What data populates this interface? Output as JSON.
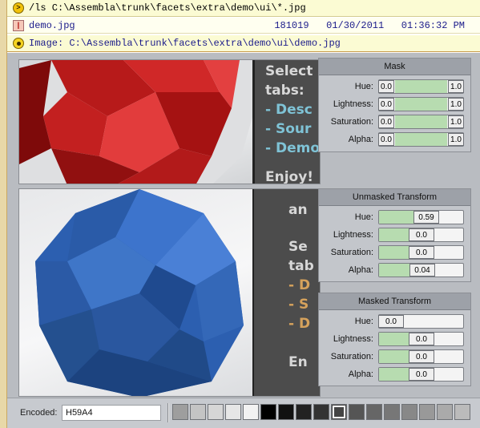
{
  "console": {
    "command": "/ls C:\\Assembla\\trunk\\facets\\extra\\demo\\ui\\*.jpg",
    "file": {
      "name": "demo.jpg",
      "size": "181019",
      "date": "01/30/2011",
      "time": "01:36:32 PM"
    },
    "image_line": "Image: C:\\Assembla\\trunk\\facets\\extra\\demo\\ui\\demo.jpg",
    "icons": [
      "prompt-icon",
      "file-icon",
      "eye-icon"
    ]
  },
  "overlay_top": [
    "Select",
    "tabs:",
    "- Desc",
    "- Sour",
    "- Demo",
    "",
    "Enjoy!"
  ],
  "overlay_bottom": [
    "",
    "an",
    "",
    "Se",
    "tab",
    "- D",
    "- S",
    "- D",
    "",
    "En"
  ],
  "mask": {
    "title": "Mask",
    "rows": [
      {
        "label": "Hue:",
        "lo": "0.0",
        "hi": "1.0",
        "fill": 1.0
      },
      {
        "label": "Lightness:",
        "lo": "0.0",
        "hi": "1.0",
        "fill": 1.0
      },
      {
        "label": "Saturation:",
        "lo": "0.0",
        "hi": "1.0",
        "fill": 1.0
      },
      {
        "label": "Alpha:",
        "lo": "0.0",
        "hi": "1.0",
        "fill": 1.0
      }
    ]
  },
  "unmasked": {
    "title": "Unmasked Transform",
    "rows": [
      {
        "label": "Hue:",
        "value": "0.59",
        "fill": 0.59
      },
      {
        "label": "Lightness:",
        "value": "0.0",
        "fill": 0.5
      },
      {
        "label": "Saturation:",
        "value": "0.0",
        "fill": 0.5
      },
      {
        "label": "Alpha:",
        "value": "0.04",
        "fill": 0.52
      }
    ]
  },
  "masked": {
    "title": "Masked Transform",
    "rows": [
      {
        "label": "Hue:",
        "value": "0.0",
        "fill": 0.0
      },
      {
        "label": "Lightness:",
        "value": "0.0",
        "fill": 0.5
      },
      {
        "label": "Saturation:",
        "value": "0.0",
        "fill": 0.5
      },
      {
        "label": "Alpha:",
        "value": "0.0",
        "fill": 0.5
      }
    ]
  },
  "encoded": {
    "label": "Encoded:",
    "value": "H59A4"
  },
  "swatches": [
    "#9e9e9e",
    "#c4c4c4",
    "#d6d6d6",
    "#e6e6e6",
    "#f2f2f2",
    "#000000",
    "#111111",
    "#222222",
    "#333333",
    "#444444",
    "#555555",
    "#666666",
    "#777777",
    "#888888",
    "#999999",
    "#aaaaaa",
    "#bbbbbb"
  ],
  "selected_swatch": 9
}
